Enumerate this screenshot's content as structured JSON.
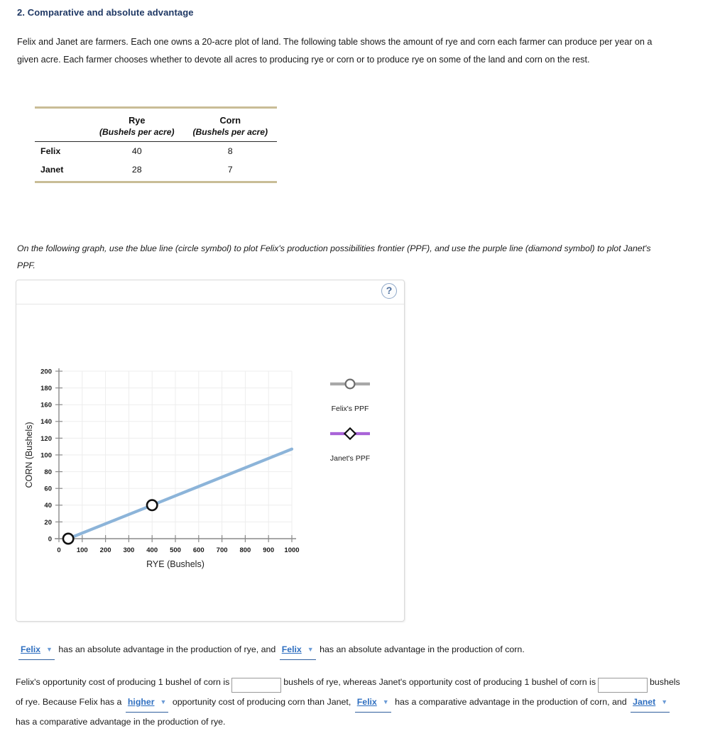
{
  "question": {
    "title": "2. Comparative and absolute advantage",
    "intro": "Felix and Janet are farmers. Each one owns a 20-acre plot of land. The following table shows the amount of rye and corn each farmer can produce per year on a given acre. Each farmer chooses whether to devote all acres to producing rye or corn or to produce rye on some of the land and corn on the rest.",
    "graph_instruction": "On the following graph, use the blue line (circle symbol) to plot Felix's production possibilities frontier (PPF), and use the purple line (diamond symbol) to plot Janet's PPF."
  },
  "table": {
    "columns": [
      {
        "name": "Rye",
        "unit": "(Bushels per acre)"
      },
      {
        "name": "Corn",
        "unit": "(Bushels per acre)"
      }
    ],
    "rows": [
      {
        "label": "Felix",
        "rye": "40",
        "corn": "8"
      },
      {
        "label": "Janet",
        "rye": "28",
        "corn": "7"
      }
    ]
  },
  "graph_panel": {
    "help_icon": "question-mark-icon",
    "help_label": "?"
  },
  "chart_data": {
    "type": "line",
    "title": "",
    "xlabel": "RYE (Bushels)",
    "ylabel": "CORN (Bushels)",
    "xlim": [
      0,
      1000
    ],
    "ylim": [
      0,
      200
    ],
    "xticks": [
      "0",
      "100",
      "200",
      "300",
      "400",
      "500",
      "600",
      "700",
      "800",
      "900",
      "1000"
    ],
    "yticks": [
      "0",
      "20",
      "40",
      "60",
      "80",
      "100",
      "120",
      "140",
      "160",
      "180",
      "200"
    ],
    "grid": true,
    "legend_position": "right",
    "series": [
      {
        "name": "Felix's PPF",
        "symbol": "circle",
        "legend_color": "#a8a8a8",
        "line_color": "#8cb4d9",
        "plotted": true,
        "points": [
          {
            "x": 40,
            "y": 0
          },
          {
            "x": 400,
            "y": 40
          },
          {
            "x": 1000,
            "y": 107
          }
        ],
        "marker_points": [
          {
            "x": 40,
            "y": 0
          },
          {
            "x": 400,
            "y": 40
          }
        ]
      },
      {
        "name": "Janet's PPF",
        "symbol": "diamond",
        "legend_color": "#a964d8",
        "line_color": "#a964d8",
        "plotted": false,
        "points": [],
        "marker_points": []
      }
    ]
  },
  "answers": {
    "sentence1": {
      "dropdown1_value": "Felix",
      "text1": "has an absolute advantage in the production of rye, and",
      "dropdown2_value": "Felix",
      "text2": "has an absolute advantage in the production of corn."
    },
    "sentence2": {
      "text1": "Felix's opportunity cost of producing 1 bushel of corn is",
      "input1_value": "",
      "text2": "bushels of rye, whereas Janet's opportunity cost of producing 1 bushel of corn is",
      "input2_value": "",
      "text3": "bushels of rye. Because Felix has a",
      "dropdown1_value": "higher",
      "text4": "opportunity cost of producing corn than Janet,",
      "dropdown2_value": "Felix",
      "text5": "has a comparative advantage in the production of corn, and",
      "dropdown3_value": "Janet",
      "text6": "has a comparative advantage in the production of rye."
    }
  },
  "icons": {
    "caret": "▼"
  }
}
